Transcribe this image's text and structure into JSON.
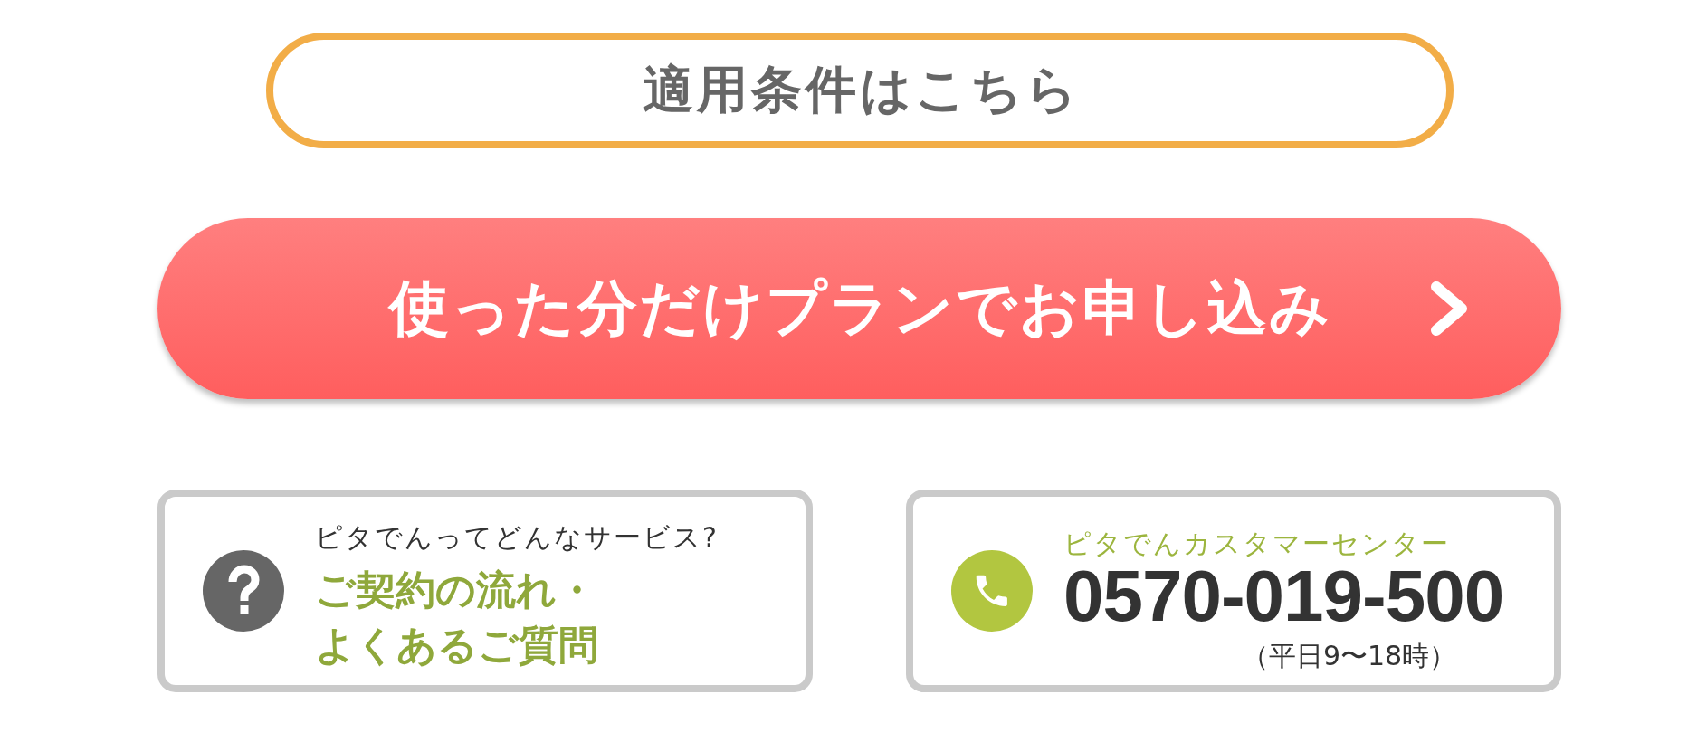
{
  "conditions_link": {
    "label": "適用条件はこちら"
  },
  "apply_button": {
    "label": "使った分だけプランでお申し込み"
  },
  "info_cards": [
    {
      "kind": "faq",
      "caption": "ピタでんってどんなサービス?",
      "title": "ご契約の流れ・よくあるご質問"
    },
    {
      "kind": "phone",
      "caption": "ピタでんカスタマーセンター",
      "phone": "0570-019-500",
      "hours": "（平日9〜18時）"
    }
  ]
}
